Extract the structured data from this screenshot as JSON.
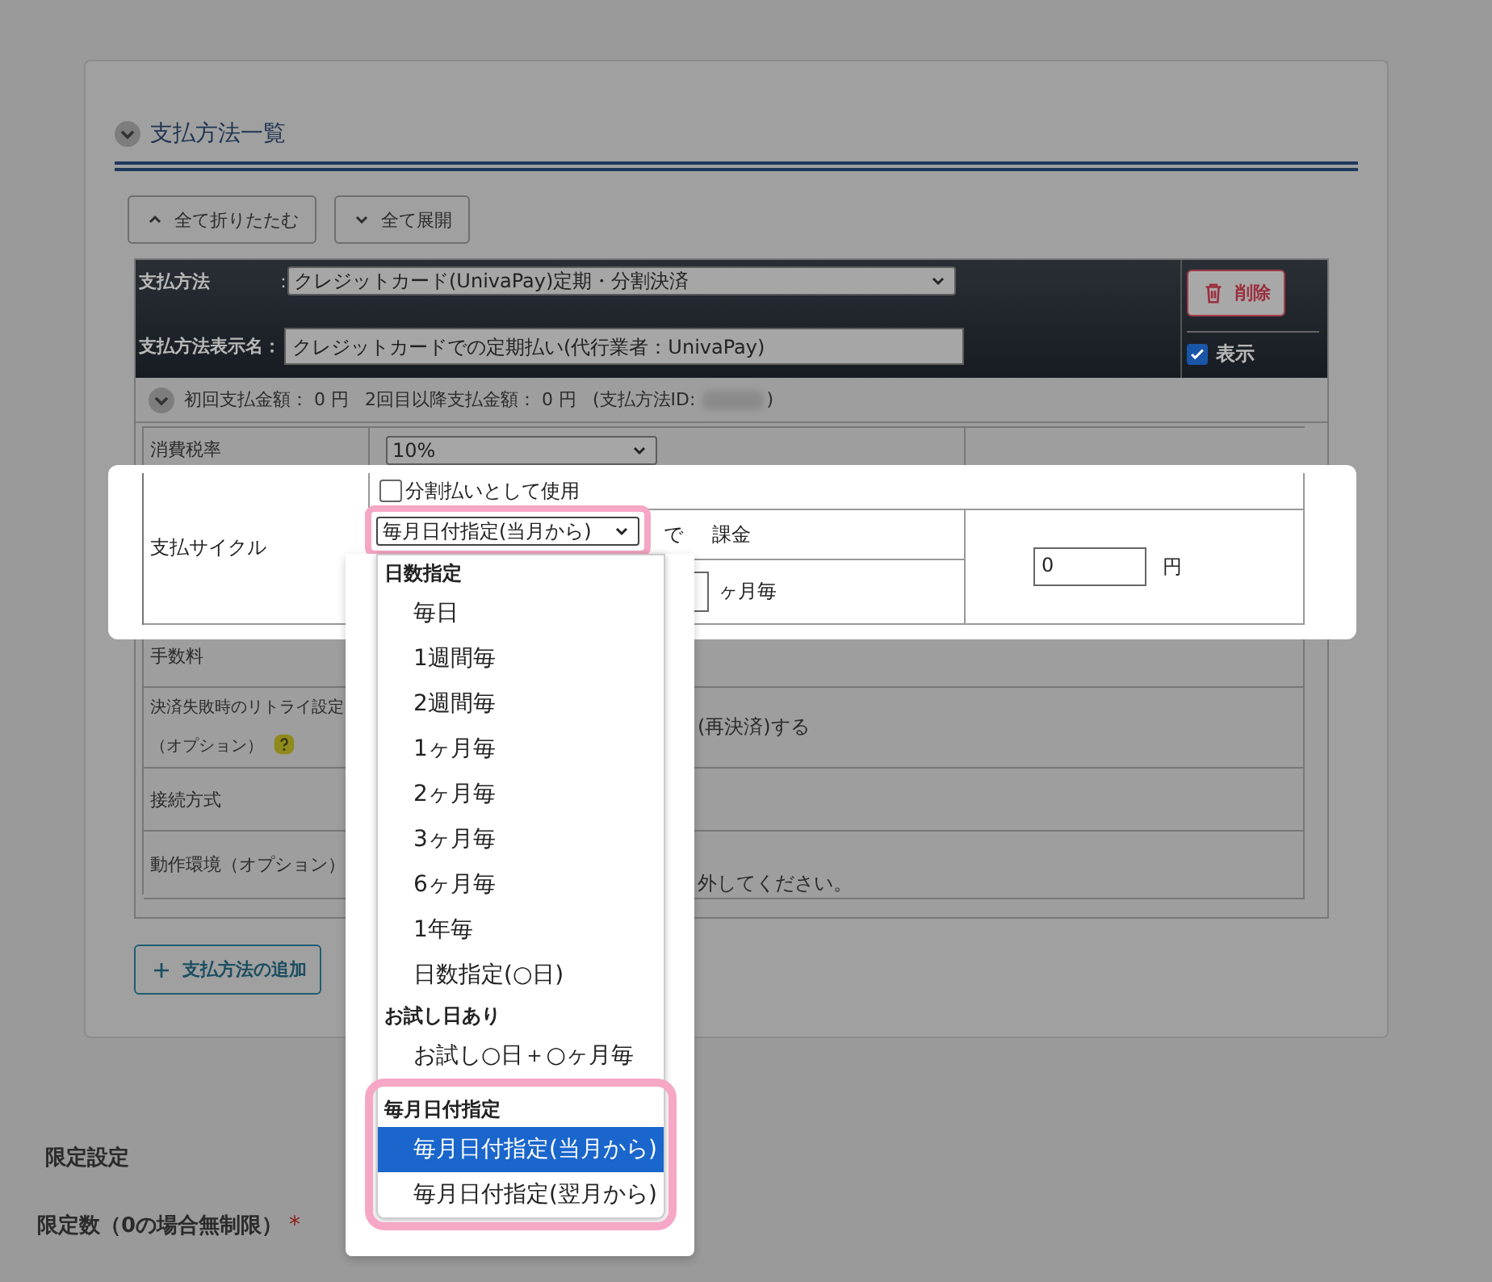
{
  "section": {
    "title": "支払方法一覧",
    "expanded": true
  },
  "toolbar": [
    {
      "label": "全て折りたたむ",
      "kind": "collapse"
    },
    {
      "label": "全て展開",
      "kind": "expand"
    }
  ],
  "method": {
    "method_label": "支払方法",
    "method_colon": "：",
    "method_value": "クレジットカード(UnivaPay)定期・分割決済",
    "name_label": "支払方法表示名：",
    "name_value": "クレジットカードでの定期払い(代行業者：UnivaPay)",
    "delete_button": "削除",
    "visible": {
      "label": "表示",
      "checked": true
    }
  },
  "summary": {
    "expanded": true,
    "first": "初回支払金額： 0 円",
    "later": "2回目以降支払金額： 0 円",
    "id_label": "(支払方法ID:",
    "id_close": ")"
  },
  "settings": [
    {
      "kind": "select",
      "label": "消費税率",
      "value": "10%"
    },
    {
      "kind": "cycle",
      "label": "支払サイクル",
      "installment": {
        "label": "分割払いとして使用",
        "checked": false
      },
      "cycle_value": "毎月日付指定(当月から)",
      "de": "で",
      "charge": "課金",
      "months_unit": "ヶ月毎",
      "amount": "0",
      "amount_unit": "円"
    },
    {
      "kind": "text",
      "label": "手数料"
    },
    {
      "kind": "text",
      "label": "決済失敗時のリトライ設定（オプション）",
      "help": true,
      "value": "(再決済)する"
    },
    {
      "kind": "text",
      "label": "接続方式"
    },
    {
      "kind": "text",
      "label": "動作環境（オプション）",
      "value": "外してください。"
    }
  ],
  "dropdown": [
    {
      "label": "日数指定",
      "options": [
        {
          "label": "毎日",
          "selected": false
        },
        {
          "label": "1週間毎",
          "selected": false
        },
        {
          "label": "2週間毎",
          "selected": false
        },
        {
          "label": "1ヶ月毎",
          "selected": false
        },
        {
          "label": "2ヶ月毎",
          "selected": false
        },
        {
          "label": "3ヶ月毎",
          "selected": false
        },
        {
          "label": "6ヶ月毎",
          "selected": false
        },
        {
          "label": "1年毎",
          "selected": false
        },
        {
          "label": "日数指定(○日)",
          "selected": false
        }
      ]
    },
    {
      "label": "お試し日あり",
      "options": [
        {
          "label": "お試し○日＋○ヶ月毎",
          "selected": false
        }
      ]
    },
    {
      "label": "毎月日付指定",
      "highlighted": true,
      "options": [
        {
          "label": "毎月日付指定(当月から)",
          "selected": true
        },
        {
          "label": "毎月日付指定(翌月から)",
          "selected": false
        }
      ]
    }
  ],
  "add_button": "支払方法の追加",
  "limits": {
    "heading": "限定設定",
    "count_label": "限定数（0の場合無制限）",
    "required_mark": "*"
  }
}
